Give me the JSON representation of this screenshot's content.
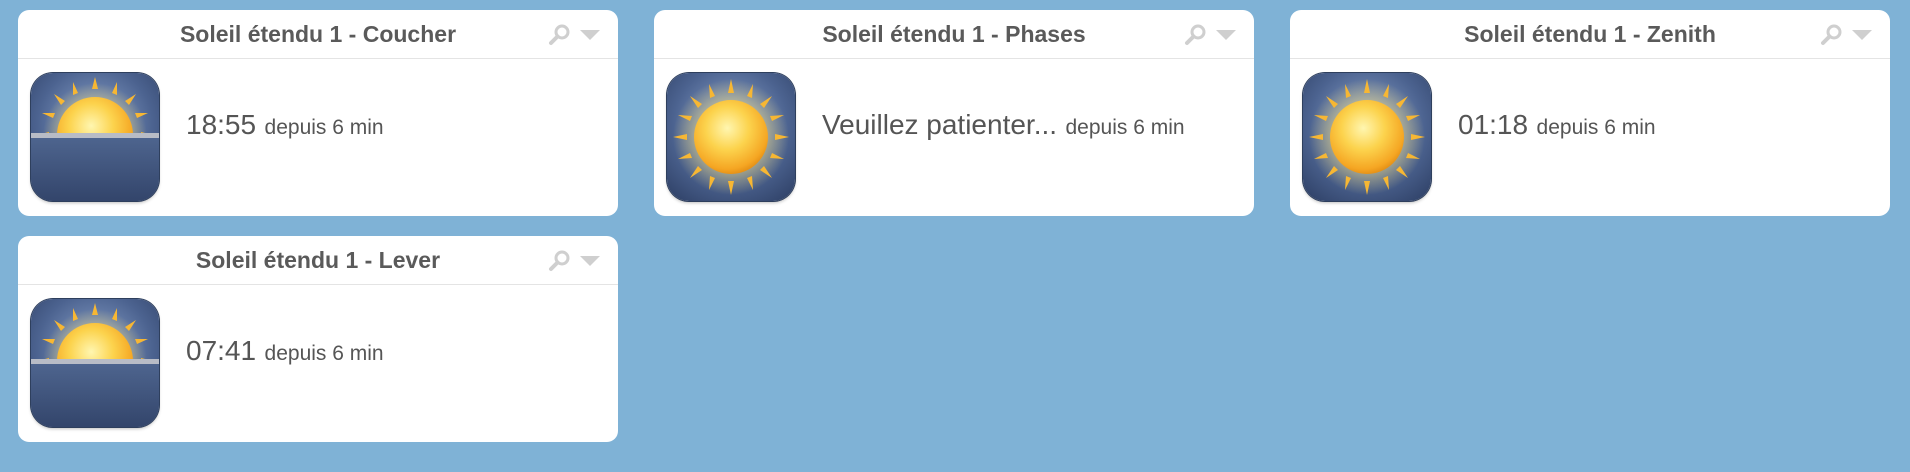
{
  "widgets": [
    {
      "title": "Soleil étendu 1 - Coucher",
      "icon": "sunset-icon",
      "value": "18:55",
      "since": "depuis 6 min"
    },
    {
      "title": "Soleil étendu 1 - Phases",
      "icon": "sun-icon",
      "value": "Veuillez patienter...",
      "since": "depuis 6 min"
    },
    {
      "title": "Soleil étendu 1 - Zenith",
      "icon": "sun-icon",
      "value": "01:18",
      "since": "depuis 6 min"
    },
    {
      "title": "Soleil étendu 1 - Lever",
      "icon": "sunrise-icon",
      "value": "07:41",
      "since": "depuis 6 min"
    }
  ],
  "colors": {
    "background": "#7fb2d6",
    "card": "#ffffff",
    "title_text": "#5a5a5a",
    "value_text": "#555555",
    "tile_blue": "#3e5480",
    "sun_core": "#fbc43a"
  },
  "icons": {
    "header_search": "magnifier-icon",
    "header_menu": "chevron-down-icon"
  }
}
